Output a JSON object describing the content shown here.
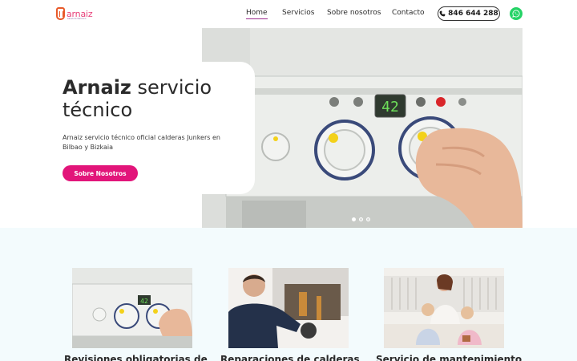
{
  "header": {
    "logo_text": "arnaiz",
    "logo_sub": "servicio técnico",
    "nav": [
      {
        "label": "Home",
        "active": true
      },
      {
        "label": "Servicios",
        "active": false
      },
      {
        "label": "Sobre nosotros",
        "active": false
      },
      {
        "label": "Contacto",
        "active": false
      }
    ],
    "phone": "846 644 288",
    "whatsapp_icon": "whatsapp-icon"
  },
  "hero": {
    "title_bold": "Arnaiz",
    "title_rest": " servicio técnico",
    "description": "Arnaiz servicio técnico oficial calderas Junkers en Bilbao y Bizkaia",
    "cta": "Sobre Nosotros",
    "slides": 3,
    "active_slide": 1,
    "boiler_display": "42"
  },
  "services": {
    "cards": [
      {
        "title": "Revisiones obligatorias de"
      },
      {
        "title": "Reparaciones de calderas"
      },
      {
        "title": "Servicio de mantenimiento"
      }
    ]
  },
  "colors": {
    "accent": "#e2157a",
    "nav_underline": "#9b2a8c",
    "whatsapp": "#25d366",
    "section_bg": "#f3fbfd"
  }
}
